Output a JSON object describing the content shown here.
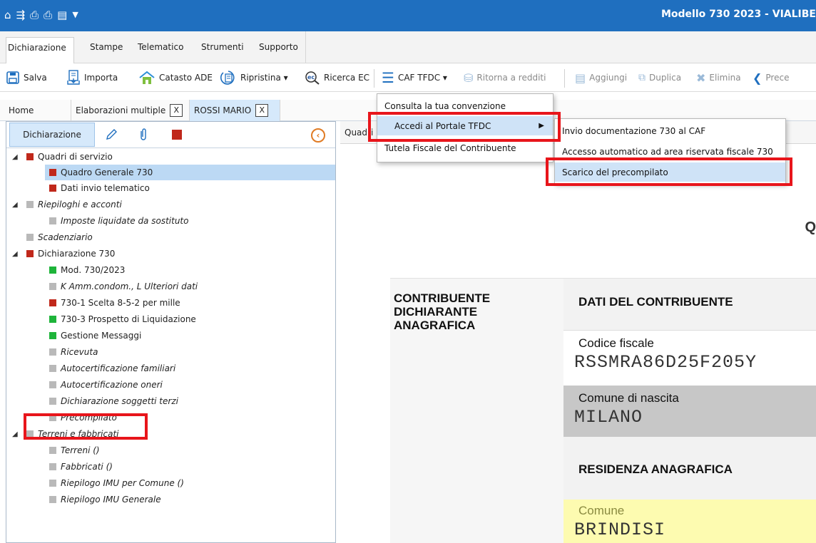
{
  "window": {
    "title": "Modello 730 2023 - VIALIBE"
  },
  "quick_access": [
    "home-icon",
    "save-flow-icon",
    "print-icon",
    "print-icon",
    "calc-icon",
    "dropdown-icon"
  ],
  "menu": {
    "items": [
      "Dichiarazione",
      "Stampe",
      "Telematico",
      "Strumenti",
      "Supporto"
    ]
  },
  "toolbar": {
    "salva": "Salva",
    "importa": "Importa",
    "catasto": "Catasto ADE",
    "ripristina": "Ripristina ▾",
    "ricerca": "Ricerca EC",
    "caf": "CAF TFDC ▾",
    "ritorna": "Ritorna a redditi",
    "aggiungi": "Aggiungi",
    "duplica": "Duplica",
    "elimina": "Elimina",
    "prece": "Prece"
  },
  "tabs": [
    {
      "label": "Home"
    },
    {
      "label": "Elaborazioni multiple",
      "close": "X"
    },
    {
      "label": "ROSSI MARIO",
      "close": "X"
    }
  ],
  "left_panel": {
    "tab_label": "Dichiarazione",
    "tree": [
      {
        "label": "Quadri di servizio",
        "color": "#c0281b"
      },
      {
        "label": "Quadro Generale 730",
        "color": "#c0281b"
      },
      {
        "label": "Dati invio telematico",
        "color": "#c0281b"
      },
      {
        "label": "Riepiloghi e acconti",
        "color": "#b9b9b9"
      },
      {
        "label": "Imposte liquidate da sostituto",
        "color": "#b9b9b9"
      },
      {
        "label": "Scadenziario",
        "color": "#b9b9b9"
      },
      {
        "label": "Dichiarazione 730",
        "color": "#c0281b"
      },
      {
        "label": "Mod. 730/2023",
        "color": "#1eb43a"
      },
      {
        "label": "K Amm.condom., L Ulteriori dati",
        "color": "#b9b9b9"
      },
      {
        "label": "730-1 Scelta 8-5-2 per mille",
        "color": "#c0281b"
      },
      {
        "label": "730-3 Prospetto di Liquidazione",
        "color": "#1eb43a"
      },
      {
        "label": "Gestione Messaggi",
        "color": "#1eb43a"
      },
      {
        "label": "Ricevuta",
        "color": "#b9b9b9"
      },
      {
        "label": "Autocertificazione familiari",
        "color": "#b9b9b9"
      },
      {
        "label": "Autocertificazione oneri",
        "color": "#b9b9b9"
      },
      {
        "label": "Dichiarazione soggetti terzi",
        "color": "#b9b9b9"
      },
      {
        "label": "Precompilato",
        "color": "#b9b9b9"
      },
      {
        "label": "Terreni e fabbricati",
        "color": "#b9b9b9"
      },
      {
        "label": "Terreni ()",
        "color": "#b9b9b9"
      },
      {
        "label": "Fabbricati ()",
        "color": "#b9b9b9"
      },
      {
        "label": "Riepilogo IMU per Comune ()",
        "color": "#b9b9b9"
      },
      {
        "label": "Riepilogo IMU Generale",
        "color": "#b9b9b9"
      }
    ]
  },
  "content": {
    "tab_label": "Quadri",
    "heading_partial": "Q",
    "section_left": [
      "CONTRIBUENTE",
      "DICHIARANTE",
      "ANAGRAFICA"
    ],
    "dati_contribuente": "DATI DEL CONTRIBUENTE",
    "codice_fiscale_label": "Codice fiscale",
    "codice_fiscale_value": "RSSMRA86D25F205Y",
    "comune_nascita_label": "Comune di nascita",
    "comune_nascita_value": "MILANO",
    "residenza": "RESIDENZA ANAGRAFICA",
    "comune_label": "Comune",
    "comune_value": "BRINDISI"
  },
  "dropdown_caf": {
    "items": [
      "Consulta la tua convenzione",
      "Accedi al Portale TFDC",
      "Tutela Fiscale del Contribuente"
    ]
  },
  "dropdown_portale": {
    "items": [
      "Invio documentazione 730 al CAF",
      "Accesso automatico ad area riservata fiscale 730",
      "Scarico del precompilato"
    ]
  }
}
